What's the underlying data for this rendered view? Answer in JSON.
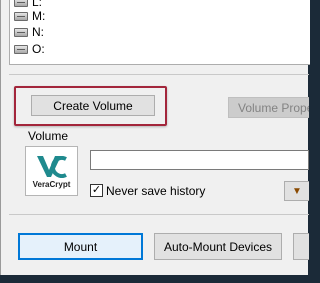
{
  "drives": [
    {
      "letter": "L:"
    },
    {
      "letter": "M:"
    },
    {
      "letter": "N:"
    },
    {
      "letter": "O:"
    }
  ],
  "buttons": {
    "create_volume": "Create Volume",
    "volume_properties": "Volume Proper",
    "mount": "Mount",
    "auto_mount": "Auto-Mount Devices"
  },
  "volume_group": {
    "label": "Volume",
    "path_value": "",
    "never_save_history": "Never save history",
    "never_save_history_checked": true,
    "checkmark": "✓"
  },
  "logo": {
    "brand": "VeraCrypt",
    "icon": "veracrypt-logo-icon"
  },
  "colors": {
    "highlight": "#a3263b",
    "logo_teal": "#1f8a8e"
  }
}
